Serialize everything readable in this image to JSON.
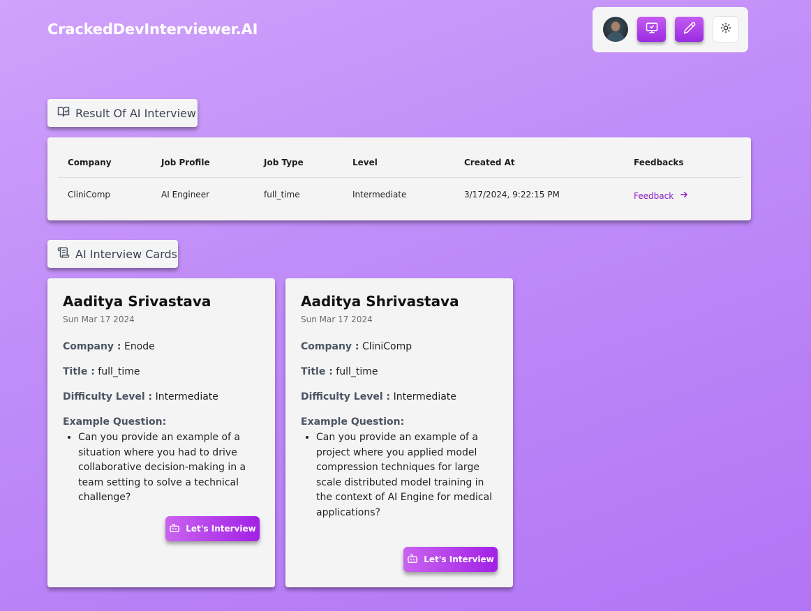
{
  "brand": {
    "title": "CrackedDevInterviewer.AI"
  },
  "topbar": {
    "icons": [
      "avatar",
      "monitor-check-icon",
      "pencil-icon",
      "sun-icon"
    ],
    "accent_color": "#a72ee5"
  },
  "result_section": {
    "label": "Result Of AI Interview",
    "icon": "book-check-icon",
    "table": {
      "headers": [
        "Company",
        "Job Profile",
        "Job Type",
        "Level",
        "Created At",
        "Feedbacks"
      ],
      "rows": [
        {
          "company": "CliniComp",
          "job_profile": "AI Engineer",
          "job_type": "full_time",
          "level": "Intermediate",
          "created_at": "3/17/2024, 9:22:15 PM",
          "feedback": "Feedback"
        }
      ]
    }
  },
  "cards_section": {
    "label": "AI Interview Cards",
    "icon": "scroll-icon",
    "labels": {
      "company": "Company :",
      "title": "Title :",
      "difficulty": "Difficulty Level :",
      "example": "Example Question:"
    },
    "cards": [
      {
        "name": "Aaditya Srivastava",
        "date": "Sun Mar 17 2024",
        "company": "Enode",
        "title": "full_time",
        "difficulty": "Intermediate",
        "question": "Can you provide an example of a situation where you had to drive collaborative decision-making in a team setting to solve a technical challenge?",
        "button": "Let's Interview"
      },
      {
        "name": "Aaditya Shrivastava",
        "date": "Sun Mar 17 2024",
        "company": "CliniComp",
        "title": "full_time",
        "difficulty": "Intermediate",
        "question": "Can you provide an example of a project where you applied model compression techniques for large scale distributed model training in the context of AI Engine for medical applications?",
        "button": "Let's Interview"
      }
    ]
  }
}
